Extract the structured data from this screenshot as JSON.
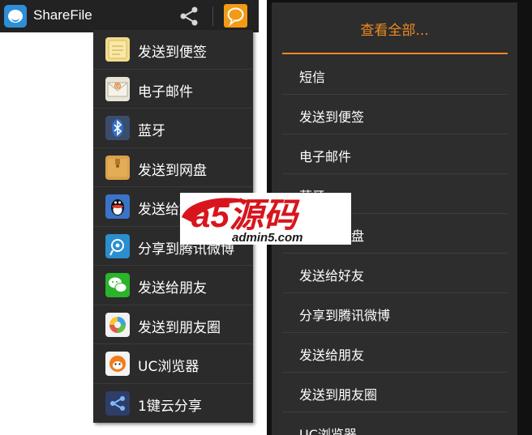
{
  "app": {
    "title": "ShareFile"
  },
  "share_menu": {
    "items": [
      {
        "label": "发送到便签",
        "icon": "note-icon"
      },
      {
        "label": "电子邮件",
        "icon": "email-icon"
      },
      {
        "label": "蓝牙",
        "icon": "bluetooth-icon"
      },
      {
        "label": "发送到网盘",
        "icon": "netdisk-icon"
      },
      {
        "label": "发送给好友",
        "icon": "qq-icon"
      },
      {
        "label": "分享到腾讯微博",
        "icon": "tencent-weibo-icon"
      },
      {
        "label": "发送给朋友",
        "icon": "wechat-icon"
      },
      {
        "label": "发送到朋友圈",
        "icon": "moments-icon"
      },
      {
        "label": "UC浏览器",
        "icon": "uc-browser-icon"
      },
      {
        "label": "1键云分享",
        "icon": "cloud-share-icon"
      }
    ]
  },
  "watermark": {
    "logo": "a5源码",
    "url": "admin5.com"
  },
  "dialog": {
    "title": "查看全部...",
    "options": [
      "短信",
      "发送到便签",
      "电子邮件",
      "蓝牙",
      "发送到网盘",
      "发送给好友",
      "分享到腾讯微博",
      "发送给朋友",
      "发送到朋友圈",
      "UC浏览器"
    ]
  },
  "colors": {
    "accent": "#EF8A1F",
    "actionbar": "#222222",
    "menu_bg": "#2B2B2B",
    "dialog_bg": "#2D2D2D"
  }
}
